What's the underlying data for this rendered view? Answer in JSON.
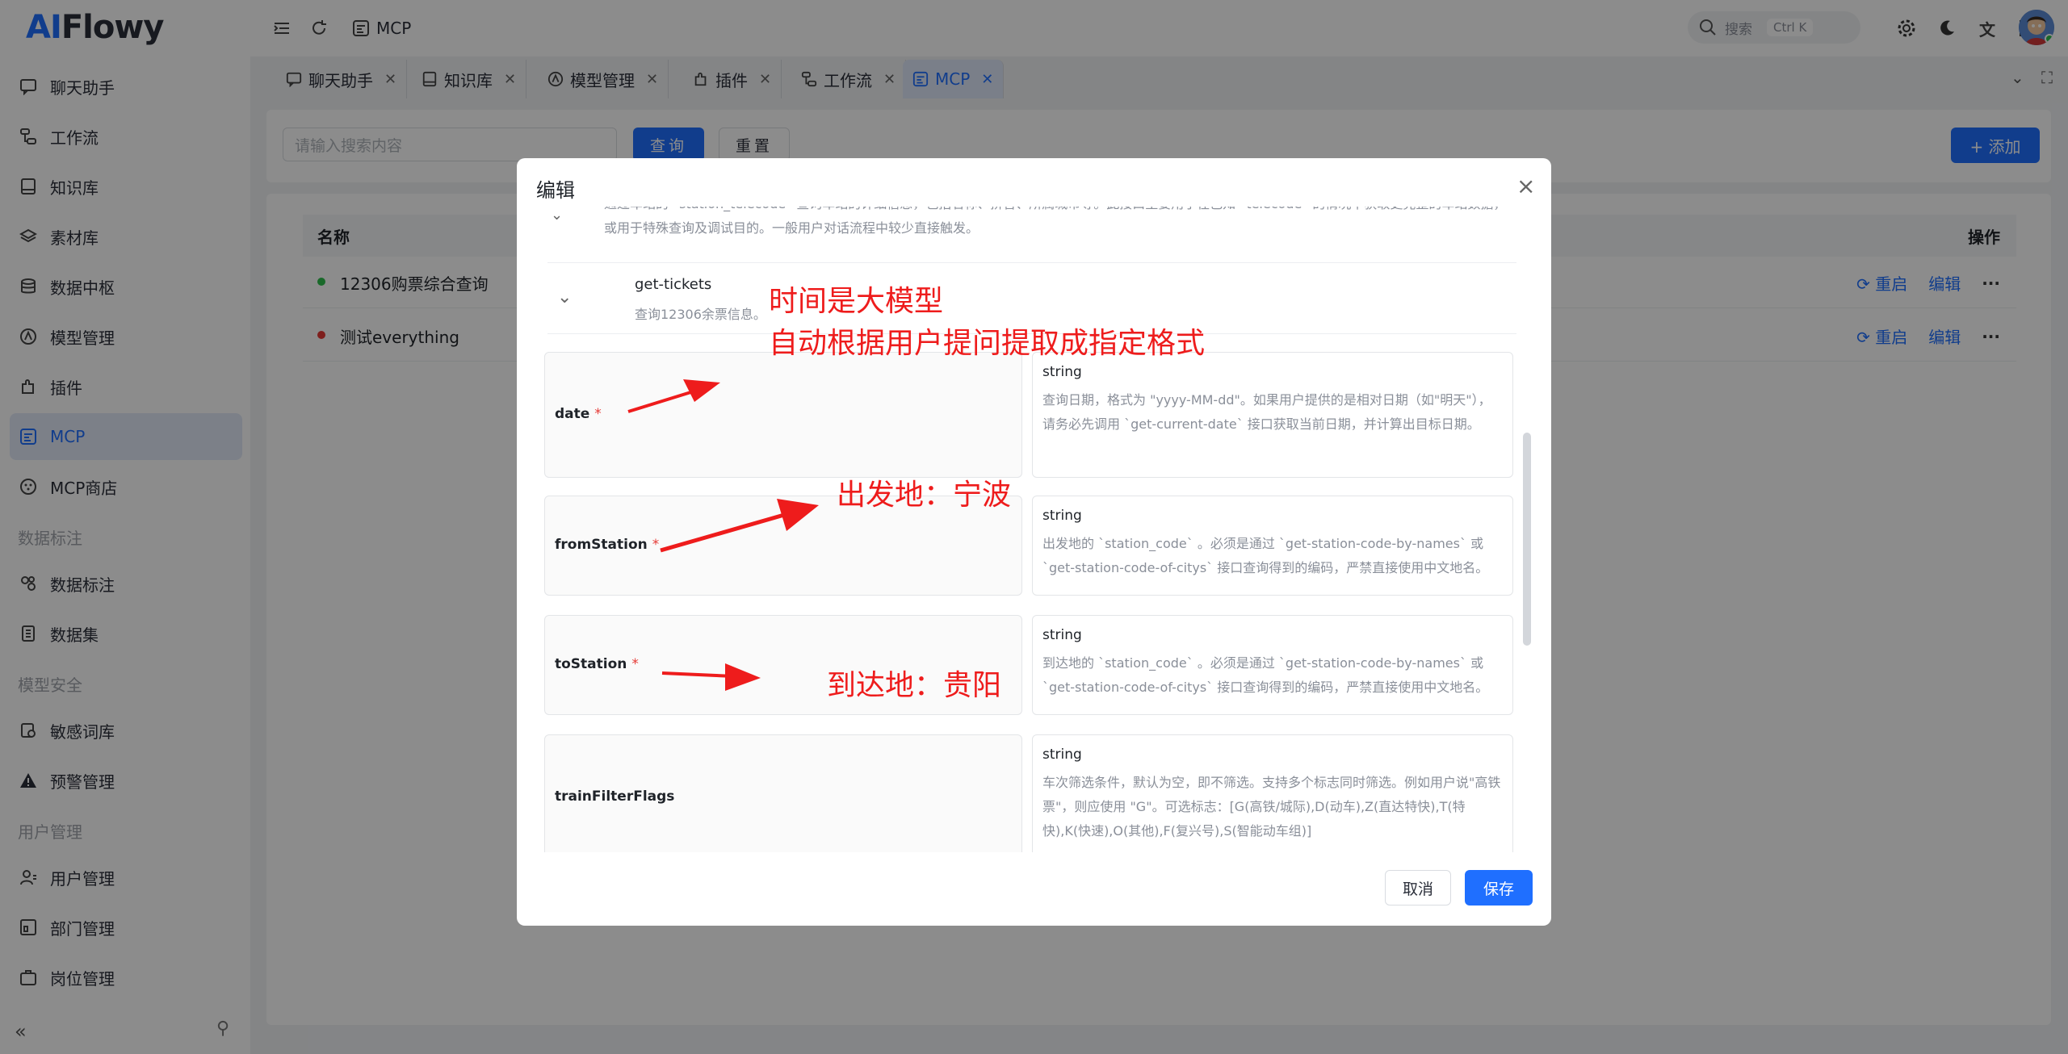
{
  "app": {
    "logo_ai": "AI",
    "logo_rest": "Flowy"
  },
  "sidebar": {
    "items": [
      {
        "label": "聊天助手",
        "icon": "chat-icon"
      },
      {
        "label": "工作流",
        "icon": "workflow-icon"
      },
      {
        "label": "知识库",
        "icon": "book-icon"
      },
      {
        "label": "素材库",
        "icon": "layers-icon"
      },
      {
        "label": "数据中枢",
        "icon": "database-icon"
      },
      {
        "label": "模型管理",
        "icon": "model-icon"
      },
      {
        "label": "插件",
        "icon": "plugin-icon"
      },
      {
        "label": "MCP",
        "icon": "mcp-icon",
        "active": true
      },
      {
        "label": "MCP商店",
        "icon": "store-icon"
      }
    ],
    "group_data_label": "数据标注",
    "group_data_items": [
      {
        "label": "数据标注",
        "icon": "label-icon"
      },
      {
        "label": "数据集",
        "icon": "dataset-icon"
      }
    ],
    "group_security": "模型安全",
    "group_security_items": [
      {
        "label": "敏感词库",
        "icon": "sensitive-icon"
      },
      {
        "label": "预警管理",
        "icon": "warning-icon"
      }
    ],
    "group_user": "用户管理",
    "group_user_items": [
      {
        "label": "用户管理",
        "icon": "user-icon"
      },
      {
        "label": "部门管理",
        "icon": "department-icon"
      },
      {
        "label": "岗位管理",
        "icon": "position-icon"
      }
    ]
  },
  "header": {
    "breadcrumb": "MCP",
    "search_placeholder": "搜索",
    "search_shortcut": "Ctrl K"
  },
  "tabs": [
    {
      "label": "聊天助手"
    },
    {
      "label": "知识库"
    },
    {
      "label": "模型管理"
    },
    {
      "label": "插件"
    },
    {
      "label": "工作流"
    },
    {
      "label": "MCP",
      "active": true
    }
  ],
  "filter": {
    "search_placeholder": "请输入搜索内容",
    "query_label": "查询",
    "reset_label": "重置",
    "add_label": "+ 添加"
  },
  "table": {
    "col_name": "名称",
    "col_action": "操作",
    "rows": [
      {
        "name": "12306购票综合查询",
        "status_color": "#2fbf4d",
        "restart": "重启",
        "edit": "编辑",
        "more": "···"
      },
      {
        "name": "测试everything",
        "status_color": "#e53935",
        "restart": "重启",
        "edit": "编辑",
        "more": "···"
      }
    ]
  },
  "modal": {
    "title": "编辑",
    "prev_tool_desc": "通过车站的 `station_telecode` 查询车站的详细信息，包括名称、拼音、所属城市等。此接口主要用于在已知 `telecode` 的情况下获取更完整的车站数据，或用于特殊查询及调试目的。一般用户对话流程中较少直接触发。",
    "tool": {
      "name": "get-tickets",
      "desc": "查询12306余票信息。"
    },
    "params": [
      {
        "name": "date",
        "required": true,
        "type": "string",
        "desc": "查询日期，格式为 \"yyyy-MM-dd\"。如果用户提供的是相对日期（如\"明天\"），请务必先调用 `get-current-date` 接口获取当前日期，并计算出目标日期。"
      },
      {
        "name": "fromStation",
        "required": true,
        "type": "string",
        "desc": "出发地的 `station_code` 。必须是通过 `get-station-code-by-names` 或 `get-station-code-of-citys` 接口查询得到的编码，严禁直接使用中文地名。"
      },
      {
        "name": "toStation",
        "required": true,
        "type": "string",
        "desc": "到达地的 `station_code` 。必须是通过 `get-station-code-by-names` 或 `get-station-code-of-citys` 接口查询得到的编码，严禁直接使用中文地名。"
      },
      {
        "name": "trainFilterFlags",
        "required": false,
        "type": "string",
        "desc": "车次筛选条件，默认为空，即不筛选。支持多个标志同时筛选。例如用户说\"高铁票\"，则应使用 \"G\"。可选标志：[G(高铁/城际),D(动车),Z(直达特快),T(特快),K(快速),O(其他),F(复兴号),S(智能动车组)]"
      }
    ],
    "required_mark": "*",
    "cancel_label": "取消",
    "save_label": "保存",
    "close_glyph": "×"
  },
  "annotations": {
    "line1": "时间是大模型",
    "line2": "自动根据用户提问提取成指定格式",
    "from": "出发地：宁波",
    "to": "到达地：贵阳",
    "color": "#ee1c1c"
  }
}
